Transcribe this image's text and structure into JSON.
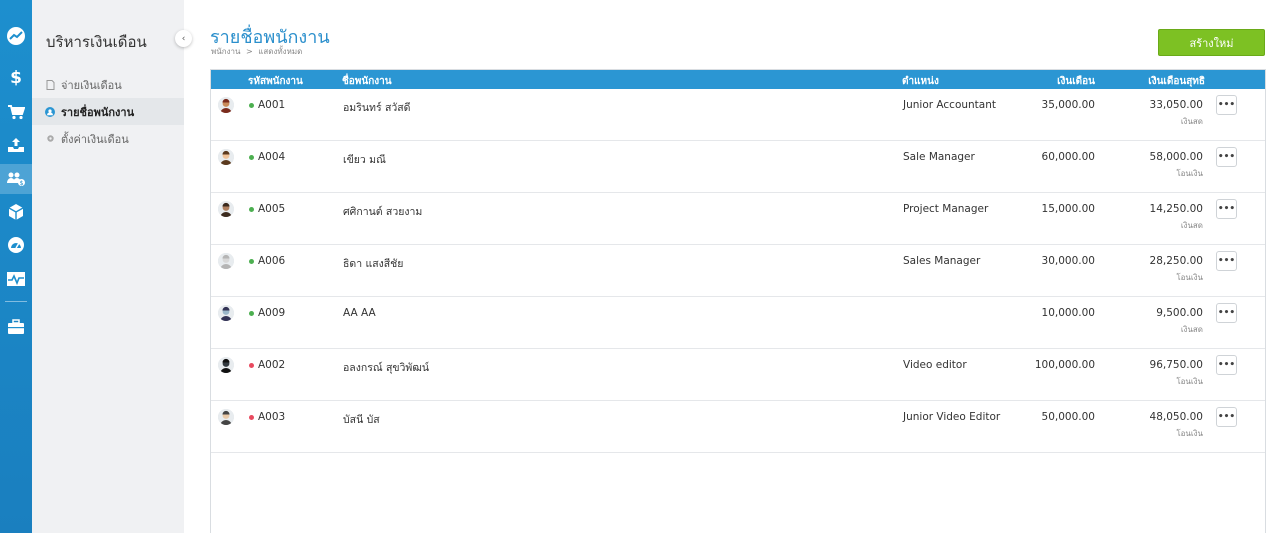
{
  "subnav": {
    "title": "บริหารเงินเดือน",
    "items": [
      {
        "label": "จ่ายเงินเดือน"
      },
      {
        "label": "รายชื่อพนักงาน"
      },
      {
        "label": "ตั้งค่าเงินเดือน"
      }
    ]
  },
  "header": {
    "title": "รายชื่อพนักงาน",
    "breadcrumb": [
      "พนักงาน",
      "แสดงทั้งหมด"
    ],
    "breadcrumb_sep": ">",
    "create_label": "สร้างใหม่"
  },
  "table": {
    "columns": {
      "code": "รหัสพนักงาน",
      "name": "ชื่อพนักงาน",
      "position": "ตำแหน่ง",
      "salary": "เงินเดือน",
      "net": "เงินเดือนสุทธิ"
    },
    "more_label": "•••",
    "rows": [
      {
        "code": "A001",
        "name": "อมรินทร์ สวัสดี",
        "position": "Junior Accountant",
        "salary": "35,000.00",
        "net": "33,050.00",
        "pay": "เงินสด",
        "status": "active"
      },
      {
        "code": "A004",
        "name": "เขียว มณี",
        "position": "Sale Manager",
        "salary": "60,000.00",
        "net": "58,000.00",
        "pay": "โอนเงิน",
        "status": "active"
      },
      {
        "code": "A005",
        "name": "ศศิกานต์ สวยงาม",
        "position": "Project Manager",
        "salary": "15,000.00",
        "net": "14,250.00",
        "pay": "เงินสด",
        "status": "active"
      },
      {
        "code": "A006",
        "name": "ธิดา แสงสีชัย",
        "position": "Sales Manager",
        "salary": "30,000.00",
        "net": "28,250.00",
        "pay": "โอนเงิน",
        "status": "active"
      },
      {
        "code": "A009",
        "name": "AA AA",
        "position": "",
        "salary": "10,000.00",
        "net": "9,500.00",
        "pay": "เงินสด",
        "status": "active"
      },
      {
        "code": "A002",
        "name": "อลงกรณ์ สุขวิพัฒน์",
        "position": "Video editor",
        "salary": "100,000.00",
        "net": "96,750.00",
        "pay": "โอนเงิน",
        "status": "inactive"
      },
      {
        "code": "A003",
        "name": "บัสนี บัส",
        "position": "Junior Video Editor",
        "salary": "50,000.00",
        "net": "48,050.00",
        "pay": "โอนเงิน",
        "status": "inactive"
      }
    ]
  },
  "colors": {
    "accent": "#2b96d3",
    "create_button": "#7dc123",
    "status_active": "#4caf50",
    "status_inactive": "#e84a5f"
  },
  "rail_icons": [
    "trend-icon",
    "dollar-icon",
    "cart-icon",
    "inbox-upload-icon",
    "people-money-icon",
    "box-icon",
    "gauge-icon",
    "pulse-chart-icon",
    "briefcase-icon"
  ]
}
